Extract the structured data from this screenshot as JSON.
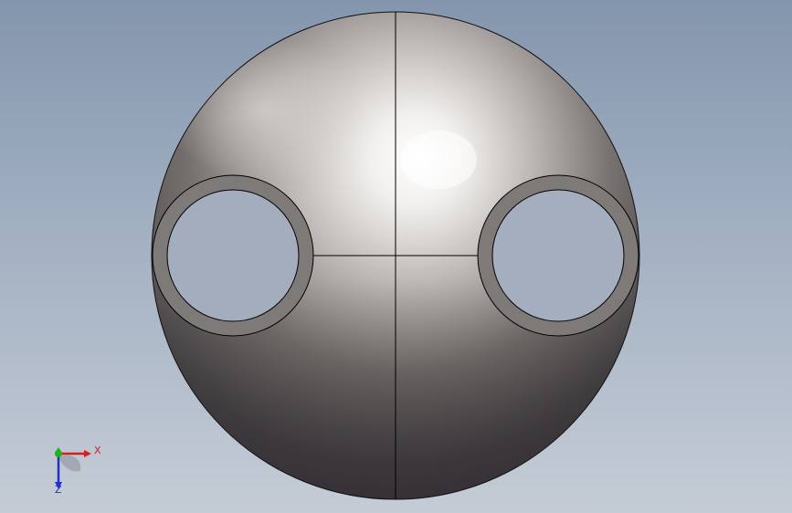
{
  "viewport": {
    "background_top": "#8496ad",
    "background_bottom": "#c5ccd6"
  },
  "model": {
    "shape": "sphere-with-two-tube-holes",
    "edge_color": "#000000",
    "tube_wall_color": "#7d7a78"
  },
  "triad": {
    "x_label": "X",
    "z_label": "Z",
    "x_color": "#d22020",
    "y_color": "#20b020",
    "z_color": "#2030c8"
  }
}
